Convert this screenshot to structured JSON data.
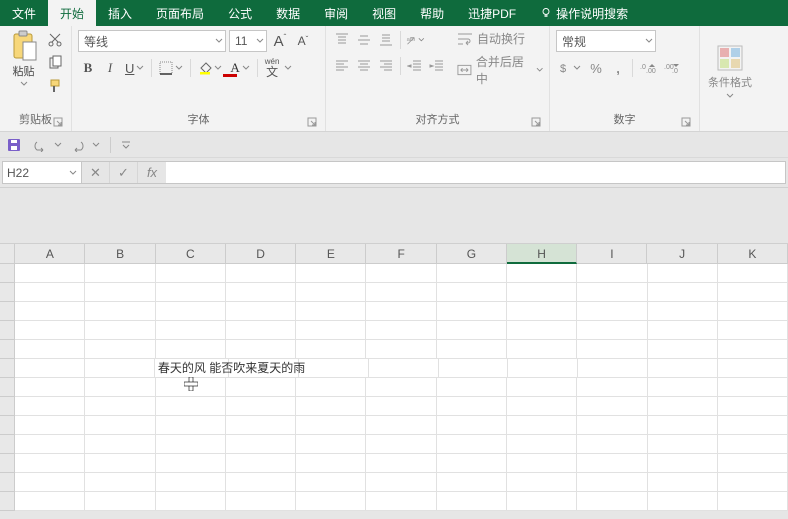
{
  "tabs": {
    "file": "文件",
    "home": "开始",
    "insert": "插入",
    "layout": "页面布局",
    "formulas": "公式",
    "data": "数据",
    "review": "审阅",
    "view": "视图",
    "help": "帮助",
    "pdf": "迅捷PDF",
    "tell_me": "操作说明搜索"
  },
  "ribbon": {
    "clipboard": {
      "paste": "粘贴",
      "label": "剪贴板"
    },
    "font": {
      "name": "等线",
      "size": "11",
      "wen": "wén",
      "label": "字体",
      "bold": "B",
      "italic": "I",
      "underline": "U",
      "grow": "A",
      "shrink": "A"
    },
    "align": {
      "wrap": "自动换行",
      "merge": "合并后居中",
      "label": "对齐方式"
    },
    "number": {
      "format": "常规",
      "label": "数字"
    },
    "cf": {
      "label": "条件格式"
    }
  },
  "namebox": "H22",
  "fx": {
    "cancel": "✕",
    "enter": "✓",
    "fx": "fx"
  },
  "columns": [
    "A",
    "B",
    "C",
    "D",
    "E",
    "F",
    "G",
    "H",
    "I",
    "J",
    "K"
  ],
  "selected_col": "H",
  "cell_text": "春天的风 能否吹来夏天的雨",
  "cell_text_row": 6,
  "cell_text_col": "C"
}
